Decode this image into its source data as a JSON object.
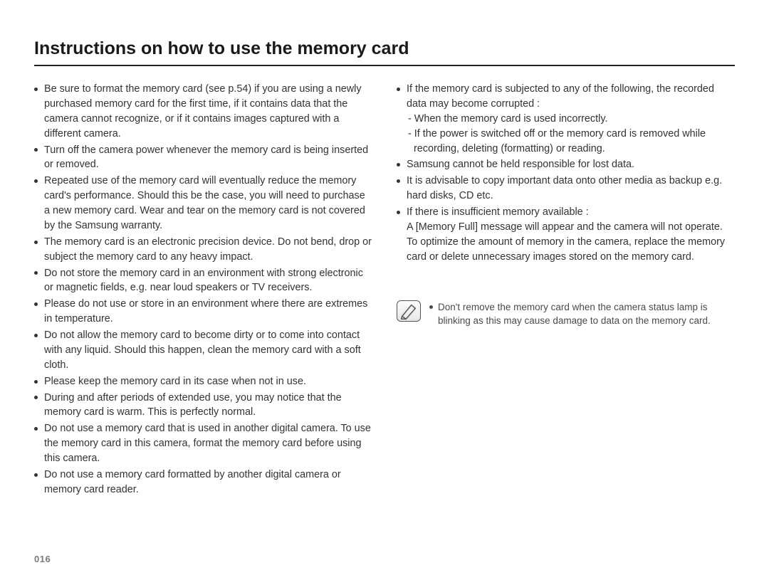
{
  "title": "Instructions on how to use the memory card",
  "page_number": "016",
  "left_bullets": [
    "Be sure to format the memory card (see p.54) if you are using a newly purchased memory card for the first time, if it contains data that the camera cannot recognize, or if it contains images captured with a different camera.",
    "Turn off the camera power whenever the memory card is being inserted or removed.",
    "Repeated use of the memory card will eventually reduce the memory card's performance. Should this be the case, you will need to purchase a new memory card. Wear and tear on the memory card is not covered by the Samsung warranty.",
    "The memory card is an electronic precision device. Do not bend, drop or subject the memory card to any heavy impact.",
    "Do not store the memory card in an environment with strong electronic or magnetic fields, e.g. near loud speakers or TV receivers.",
    "Please do not use or store in an environment where there are extremes in temperature.",
    "Do not allow the memory card to become dirty or to come into contact with any liquid. Should this happen, clean the memory card with a soft cloth.",
    "Please keep the memory card in its case when not in use.",
    "During and after periods of extended use, you may notice that the memory card is warm. This is perfectly normal.",
    "Do not use a memory card that is used in another digital camera. To use the memory card in this camera, format the memory card before using this camera.",
    "Do not use a memory card formatted by another digital camera or memory card reader."
  ],
  "right_bullets": [
    {
      "text": "If the memory card is subjected to any of the following, the recorded data may become corrupted :",
      "sub": [
        "- When the memory card is used incorrectly.",
        "- If the power is switched off or the memory card is removed while recording, deleting (formatting) or reading."
      ]
    },
    {
      "text": "Samsung cannot be held responsible for lost data."
    },
    {
      "text": "It is advisable to copy important data onto other media as backup e.g. hard disks, CD etc."
    },
    {
      "text": "If there is insufficient memory available :",
      "cont": "A [Memory Full] message will appear and the camera will not operate. To optimize the amount of memory in the camera, replace the memory card or delete unnecessary images stored on the memory card."
    }
  ],
  "note_bullets": [
    "Don't remove the memory card when the camera status lamp is blinking as this may cause damage to data on the memory card."
  ]
}
